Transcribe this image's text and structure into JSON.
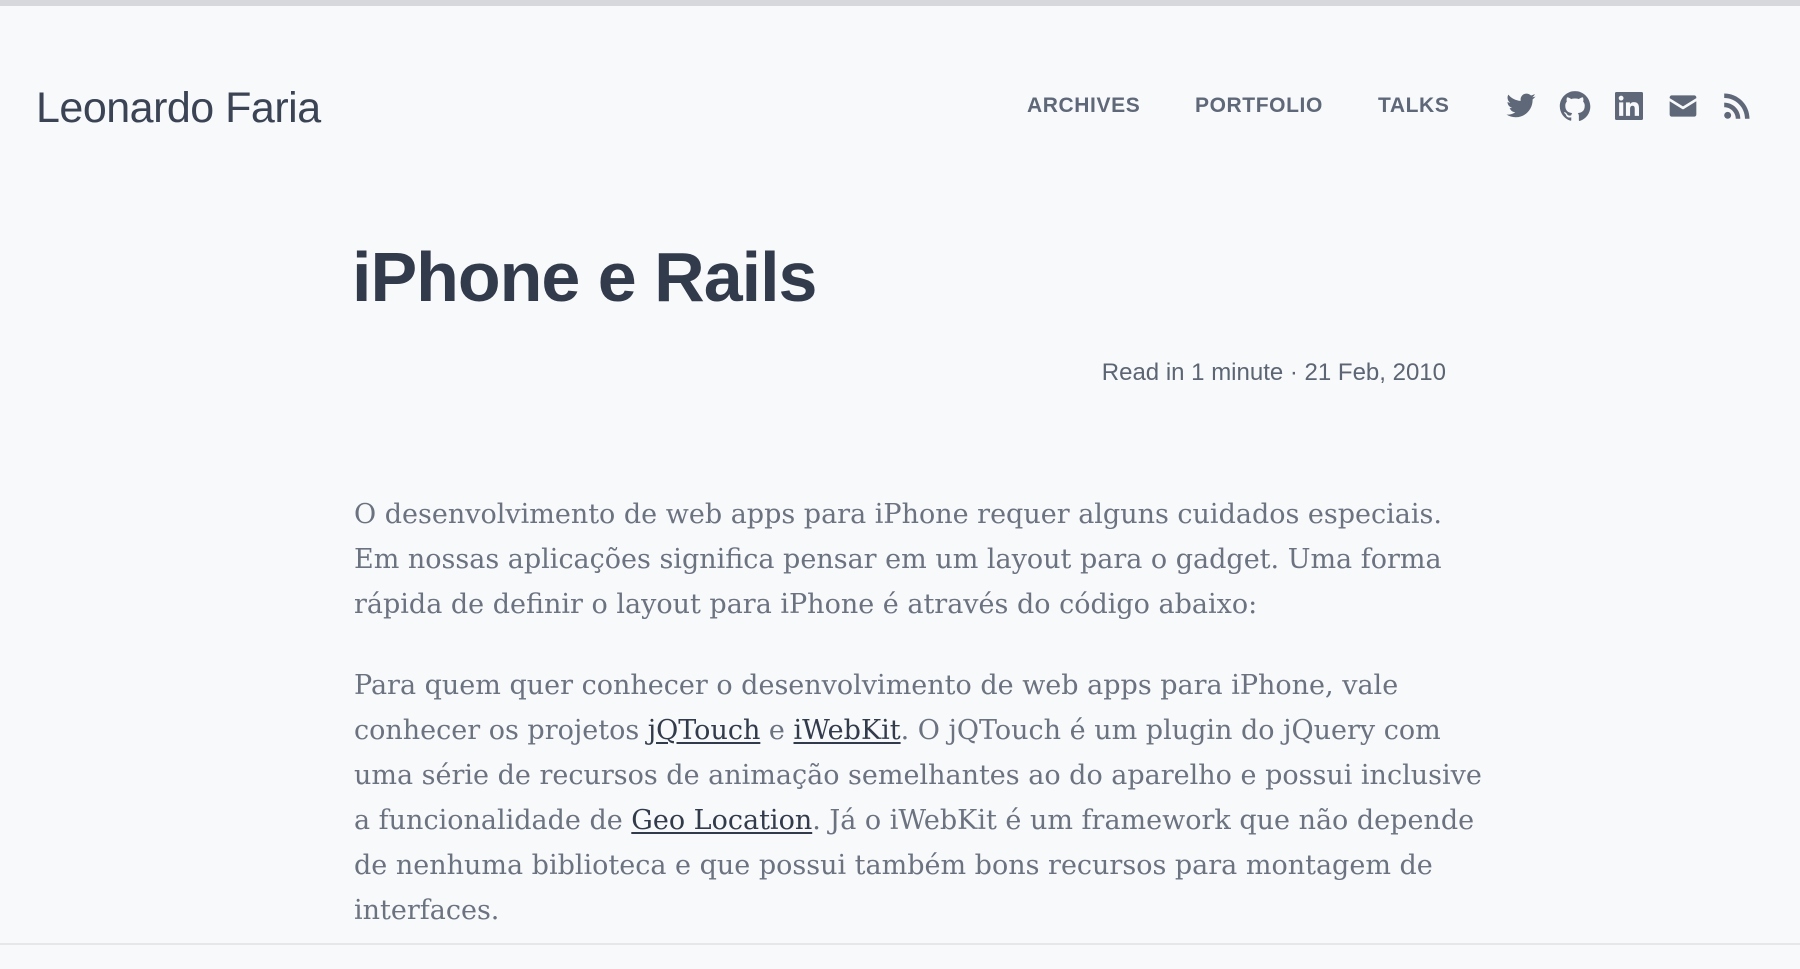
{
  "header": {
    "site_title": "Leonardo Faria",
    "nav": [
      {
        "label": "ARCHIVES"
      },
      {
        "label": "PORTFOLIO"
      },
      {
        "label": "TALKS"
      }
    ],
    "social_icons": [
      "twitter-icon",
      "github-icon",
      "linkedin-icon",
      "mail-icon",
      "rss-icon"
    ]
  },
  "post": {
    "title": "iPhone e Rails",
    "meta": "Read in 1 minute · 21 Feb, 2010",
    "paragraph1": {
      "lines": [
        "O desenvolvimento de web apps para iPhone requer alguns cuidados especiais.",
        "Em nossas aplicações significa pensar em um layout para o gadget. Uma forma",
        "rápida de definir o layout para iPhone é através do código abaixo:"
      ]
    },
    "paragraph2": {
      "line1": "Para quem quer conhecer o desenvolvimento de web apps para iPhone, vale",
      "line2_before": "conhecer os projetos ",
      "link_jqtouch": "jQTouch",
      "line2_mid": " e ",
      "link_iwebkit": "iWebKit",
      "line2_after": ". O jQTouch é um plugin do jQuery com",
      "line3": "uma série de recursos de animação semelhantes ao do aparelho e possui inclusive",
      "line4_before": "a funcionalidade de ",
      "link_geolocation": "Geo Location",
      "line4_after": ". Já o iWebKit é um framework que não depende",
      "line5": "de nenhuma biblioteca e que possui também bons recursos para montagem de",
      "line6": "interfaces."
    }
  },
  "colors": {
    "background": "#f8f9fa",
    "title": "#323b4b",
    "nav": "#5f6878",
    "body_text": "#6b7280",
    "link": "#323b4b"
  }
}
